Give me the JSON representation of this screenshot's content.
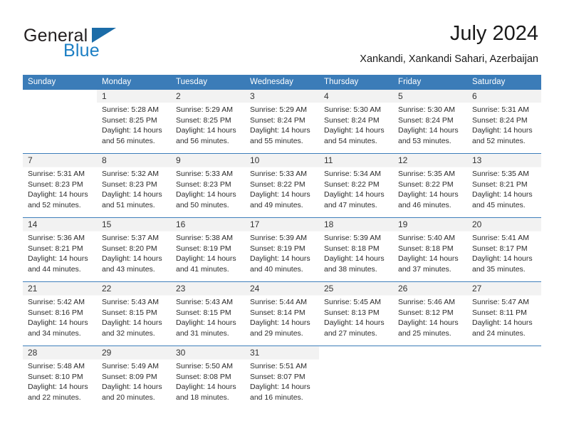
{
  "brand": {
    "name_part1": "General",
    "name_part2": "Blue",
    "logo_icon": "triangle-icon",
    "accent_color": "#1b6ca8"
  },
  "header": {
    "title": "July 2024",
    "subtitle": "Xankandi, Xankandi Sahari, Azerbaijan"
  },
  "calendar": {
    "header_bg": "#3b7cb8",
    "daynum_bg": "#f2f2f2",
    "columns": [
      "Sunday",
      "Monday",
      "Tuesday",
      "Wednesday",
      "Thursday",
      "Friday",
      "Saturday"
    ],
    "weeks": [
      [
        {
          "day": "",
          "sunrise": "",
          "sunset": "",
          "daylight1": "",
          "daylight2": ""
        },
        {
          "day": "1",
          "sunrise": "Sunrise: 5:28 AM",
          "sunset": "Sunset: 8:25 PM",
          "daylight1": "Daylight: 14 hours",
          "daylight2": "and 56 minutes."
        },
        {
          "day": "2",
          "sunrise": "Sunrise: 5:29 AM",
          "sunset": "Sunset: 8:25 PM",
          "daylight1": "Daylight: 14 hours",
          "daylight2": "and 56 minutes."
        },
        {
          "day": "3",
          "sunrise": "Sunrise: 5:29 AM",
          "sunset": "Sunset: 8:24 PM",
          "daylight1": "Daylight: 14 hours",
          "daylight2": "and 55 minutes."
        },
        {
          "day": "4",
          "sunrise": "Sunrise: 5:30 AM",
          "sunset": "Sunset: 8:24 PM",
          "daylight1": "Daylight: 14 hours",
          "daylight2": "and 54 minutes."
        },
        {
          "day": "5",
          "sunrise": "Sunrise: 5:30 AM",
          "sunset": "Sunset: 8:24 PM",
          "daylight1": "Daylight: 14 hours",
          "daylight2": "and 53 minutes."
        },
        {
          "day": "6",
          "sunrise": "Sunrise: 5:31 AM",
          "sunset": "Sunset: 8:24 PM",
          "daylight1": "Daylight: 14 hours",
          "daylight2": "and 52 minutes."
        }
      ],
      [
        {
          "day": "7",
          "sunrise": "Sunrise: 5:31 AM",
          "sunset": "Sunset: 8:23 PM",
          "daylight1": "Daylight: 14 hours",
          "daylight2": "and 52 minutes."
        },
        {
          "day": "8",
          "sunrise": "Sunrise: 5:32 AM",
          "sunset": "Sunset: 8:23 PM",
          "daylight1": "Daylight: 14 hours",
          "daylight2": "and 51 minutes."
        },
        {
          "day": "9",
          "sunrise": "Sunrise: 5:33 AM",
          "sunset": "Sunset: 8:23 PM",
          "daylight1": "Daylight: 14 hours",
          "daylight2": "and 50 minutes."
        },
        {
          "day": "10",
          "sunrise": "Sunrise: 5:33 AM",
          "sunset": "Sunset: 8:22 PM",
          "daylight1": "Daylight: 14 hours",
          "daylight2": "and 49 minutes."
        },
        {
          "day": "11",
          "sunrise": "Sunrise: 5:34 AM",
          "sunset": "Sunset: 8:22 PM",
          "daylight1": "Daylight: 14 hours",
          "daylight2": "and 47 minutes."
        },
        {
          "day": "12",
          "sunrise": "Sunrise: 5:35 AM",
          "sunset": "Sunset: 8:22 PM",
          "daylight1": "Daylight: 14 hours",
          "daylight2": "and 46 minutes."
        },
        {
          "day": "13",
          "sunrise": "Sunrise: 5:35 AM",
          "sunset": "Sunset: 8:21 PM",
          "daylight1": "Daylight: 14 hours",
          "daylight2": "and 45 minutes."
        }
      ],
      [
        {
          "day": "14",
          "sunrise": "Sunrise: 5:36 AM",
          "sunset": "Sunset: 8:21 PM",
          "daylight1": "Daylight: 14 hours",
          "daylight2": "and 44 minutes."
        },
        {
          "day": "15",
          "sunrise": "Sunrise: 5:37 AM",
          "sunset": "Sunset: 8:20 PM",
          "daylight1": "Daylight: 14 hours",
          "daylight2": "and 43 minutes."
        },
        {
          "day": "16",
          "sunrise": "Sunrise: 5:38 AM",
          "sunset": "Sunset: 8:19 PM",
          "daylight1": "Daylight: 14 hours",
          "daylight2": "and 41 minutes."
        },
        {
          "day": "17",
          "sunrise": "Sunrise: 5:39 AM",
          "sunset": "Sunset: 8:19 PM",
          "daylight1": "Daylight: 14 hours",
          "daylight2": "and 40 minutes."
        },
        {
          "day": "18",
          "sunrise": "Sunrise: 5:39 AM",
          "sunset": "Sunset: 8:18 PM",
          "daylight1": "Daylight: 14 hours",
          "daylight2": "and 38 minutes."
        },
        {
          "day": "19",
          "sunrise": "Sunrise: 5:40 AM",
          "sunset": "Sunset: 8:18 PM",
          "daylight1": "Daylight: 14 hours",
          "daylight2": "and 37 minutes."
        },
        {
          "day": "20",
          "sunrise": "Sunrise: 5:41 AM",
          "sunset": "Sunset: 8:17 PM",
          "daylight1": "Daylight: 14 hours",
          "daylight2": "and 35 minutes."
        }
      ],
      [
        {
          "day": "21",
          "sunrise": "Sunrise: 5:42 AM",
          "sunset": "Sunset: 8:16 PM",
          "daylight1": "Daylight: 14 hours",
          "daylight2": "and 34 minutes."
        },
        {
          "day": "22",
          "sunrise": "Sunrise: 5:43 AM",
          "sunset": "Sunset: 8:15 PM",
          "daylight1": "Daylight: 14 hours",
          "daylight2": "and 32 minutes."
        },
        {
          "day": "23",
          "sunrise": "Sunrise: 5:43 AM",
          "sunset": "Sunset: 8:15 PM",
          "daylight1": "Daylight: 14 hours",
          "daylight2": "and 31 minutes."
        },
        {
          "day": "24",
          "sunrise": "Sunrise: 5:44 AM",
          "sunset": "Sunset: 8:14 PM",
          "daylight1": "Daylight: 14 hours",
          "daylight2": "and 29 minutes."
        },
        {
          "day": "25",
          "sunrise": "Sunrise: 5:45 AM",
          "sunset": "Sunset: 8:13 PM",
          "daylight1": "Daylight: 14 hours",
          "daylight2": "and 27 minutes."
        },
        {
          "day": "26",
          "sunrise": "Sunrise: 5:46 AM",
          "sunset": "Sunset: 8:12 PM",
          "daylight1": "Daylight: 14 hours",
          "daylight2": "and 25 minutes."
        },
        {
          "day": "27",
          "sunrise": "Sunrise: 5:47 AM",
          "sunset": "Sunset: 8:11 PM",
          "daylight1": "Daylight: 14 hours",
          "daylight2": "and 24 minutes."
        }
      ],
      [
        {
          "day": "28",
          "sunrise": "Sunrise: 5:48 AM",
          "sunset": "Sunset: 8:10 PM",
          "daylight1": "Daylight: 14 hours",
          "daylight2": "and 22 minutes."
        },
        {
          "day": "29",
          "sunrise": "Sunrise: 5:49 AM",
          "sunset": "Sunset: 8:09 PM",
          "daylight1": "Daylight: 14 hours",
          "daylight2": "and 20 minutes."
        },
        {
          "day": "30",
          "sunrise": "Sunrise: 5:50 AM",
          "sunset": "Sunset: 8:08 PM",
          "daylight1": "Daylight: 14 hours",
          "daylight2": "and 18 minutes."
        },
        {
          "day": "31",
          "sunrise": "Sunrise: 5:51 AM",
          "sunset": "Sunset: 8:07 PM",
          "daylight1": "Daylight: 14 hours",
          "daylight2": "and 16 minutes."
        },
        {
          "day": "",
          "sunrise": "",
          "sunset": "",
          "daylight1": "",
          "daylight2": ""
        },
        {
          "day": "",
          "sunrise": "",
          "sunset": "",
          "daylight1": "",
          "daylight2": ""
        },
        {
          "day": "",
          "sunrise": "",
          "sunset": "",
          "daylight1": "",
          "daylight2": ""
        }
      ]
    ]
  }
}
